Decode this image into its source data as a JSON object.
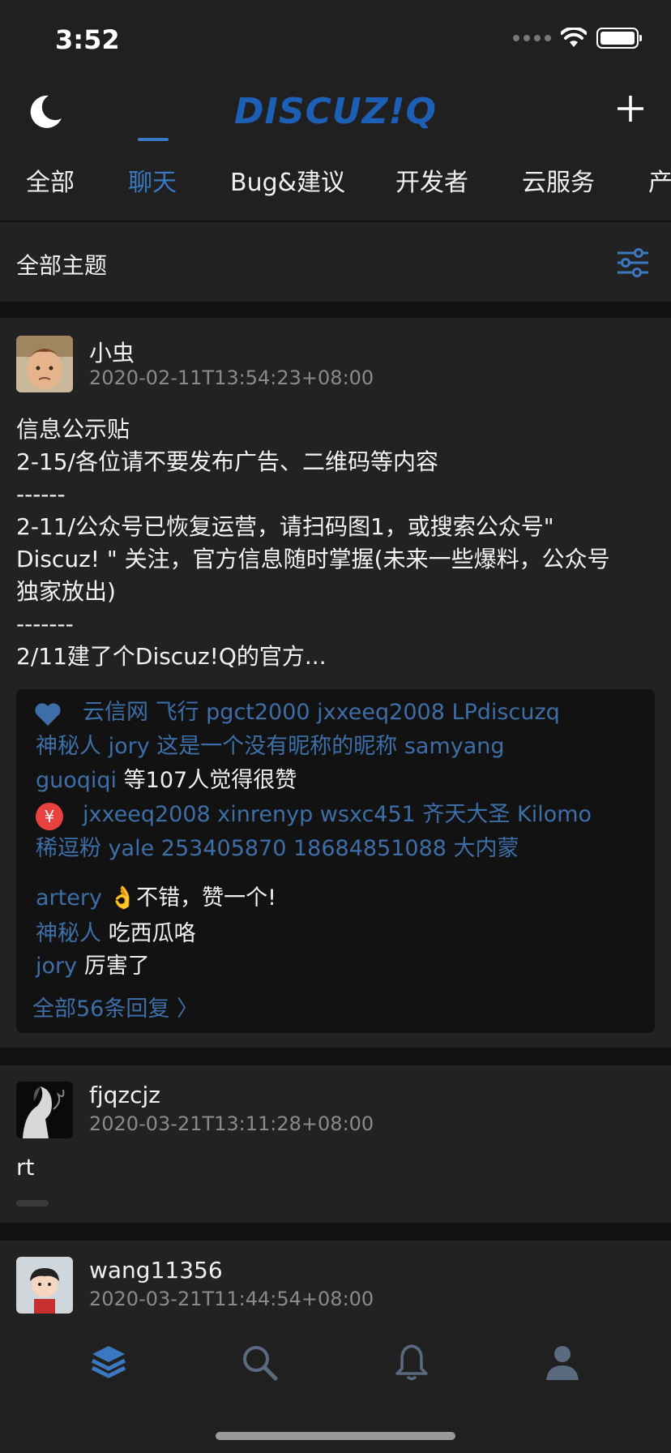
{
  "status_bar": {
    "time": "3:52"
  },
  "header": {
    "logo": "DISCUZ!Q",
    "tabs": [
      "全部",
      "聊天",
      "Bug&建议",
      "开发者",
      "云服务",
      "产"
    ],
    "active_tab": "聊天"
  },
  "subheader": {
    "title": "全部主题"
  },
  "posts": [
    {
      "username": "小虫",
      "time": "2020-02-11T13:54:23+08:00",
      "body_lines": [
        "信息公示贴",
        "2-15/各位请不要发布广告、二维码等内容",
        "------",
        "2-11/公众号已恢复运营，请扫码图1，或搜索公众号\"",
        "Discuz! \" 关注，官方信息随时掌握(未来一些爆料，公众号",
        "独家放出)",
        "-------",
        "2/11建了个Discuz!Q的官方..."
      ],
      "likes": {
        "line1": "云信网 飞行 pgct2000 jxxeeq2008 LPdiscuzq",
        "line2": "神秘人 jory 这是一个没有昵称的昵称 samyang",
        "line3_name": "guoqiqi",
        "line3_suffix": "等107人觉得很赞"
      },
      "rewards": {
        "badge": "¥",
        "line1": "jxxeeq2008 xinrenyp wsxc451 齐天大圣 Kilomo",
        "line2": "稀逗粉 yale 253405870 18684851088 大内蒙"
      },
      "replies": [
        {
          "name": "artery",
          "text": "👌不错，赞一个!"
        },
        {
          "name": "神秘人",
          "text": "吃西瓜咯"
        },
        {
          "name": "jory",
          "text": "厉害了"
        }
      ],
      "all_replies": "全部56条回复  〉"
    },
    {
      "username": "fjqzcjz",
      "time": "2020-03-21T13:11:28+08:00",
      "body": "rt"
    },
    {
      "username": "wang11356",
      "time": "2020-03-21T11:44:54+08:00"
    }
  ],
  "tabbar": {
    "items": [
      "home-icon",
      "search-icon",
      "bell-icon",
      "user-icon"
    ],
    "active": "home-icon"
  },
  "colors": {
    "accent": "#3a78c2",
    "background": "#131313",
    "card": "#222222"
  }
}
